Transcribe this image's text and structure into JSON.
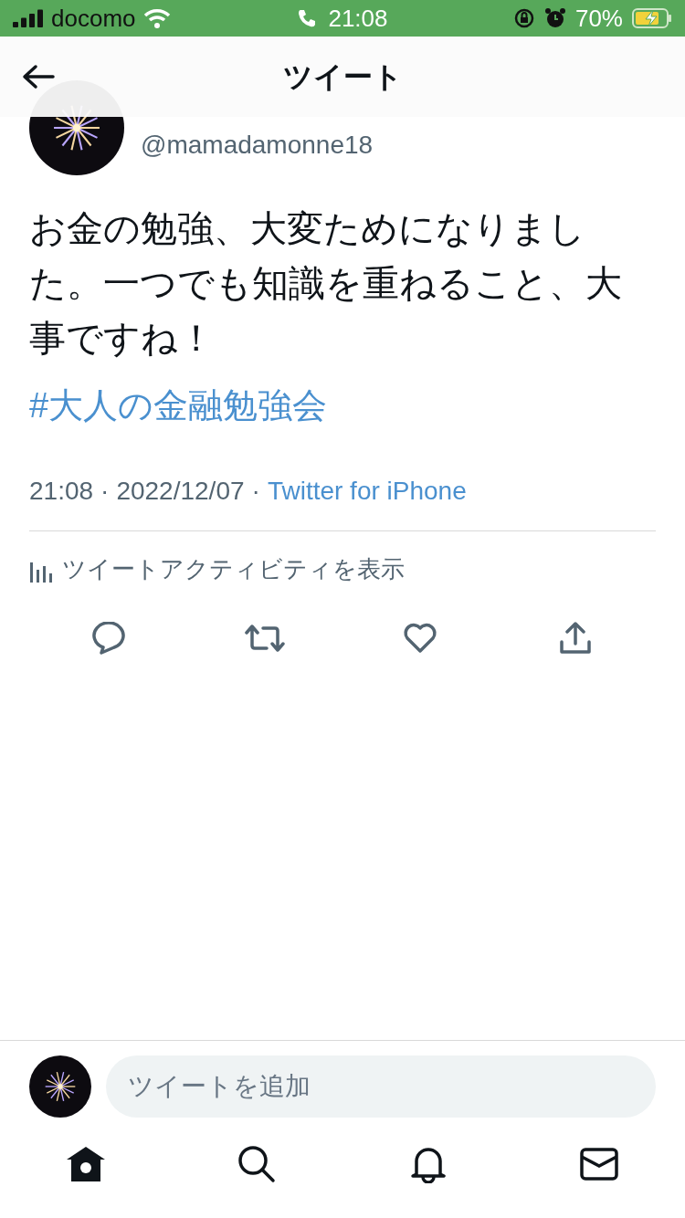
{
  "status_bar": {
    "carrier": "docomo",
    "time": "21:08",
    "battery": "70%"
  },
  "header": {
    "title": "ツイート"
  },
  "tweet": {
    "handle": "@mamadamonne18",
    "text": "お金の勉強、大変ためになりました。一つでも知識を重ねること、大事ですね！",
    "hashtag": "#大人の金融勉強会",
    "time": "21:08",
    "separator": "·",
    "date": "2022/12/07",
    "source": "Twitter for iPhone",
    "activity": "ツイートアクティビティを表示"
  },
  "reply": {
    "placeholder": "ツイートを追加"
  },
  "tab_bar": [
    {
      "kind": "home",
      "selected": true
    },
    {
      "kind": "search",
      "selected": false
    },
    {
      "kind": "notifications",
      "selected": false
    },
    {
      "kind": "messages",
      "selected": false
    }
  ]
}
